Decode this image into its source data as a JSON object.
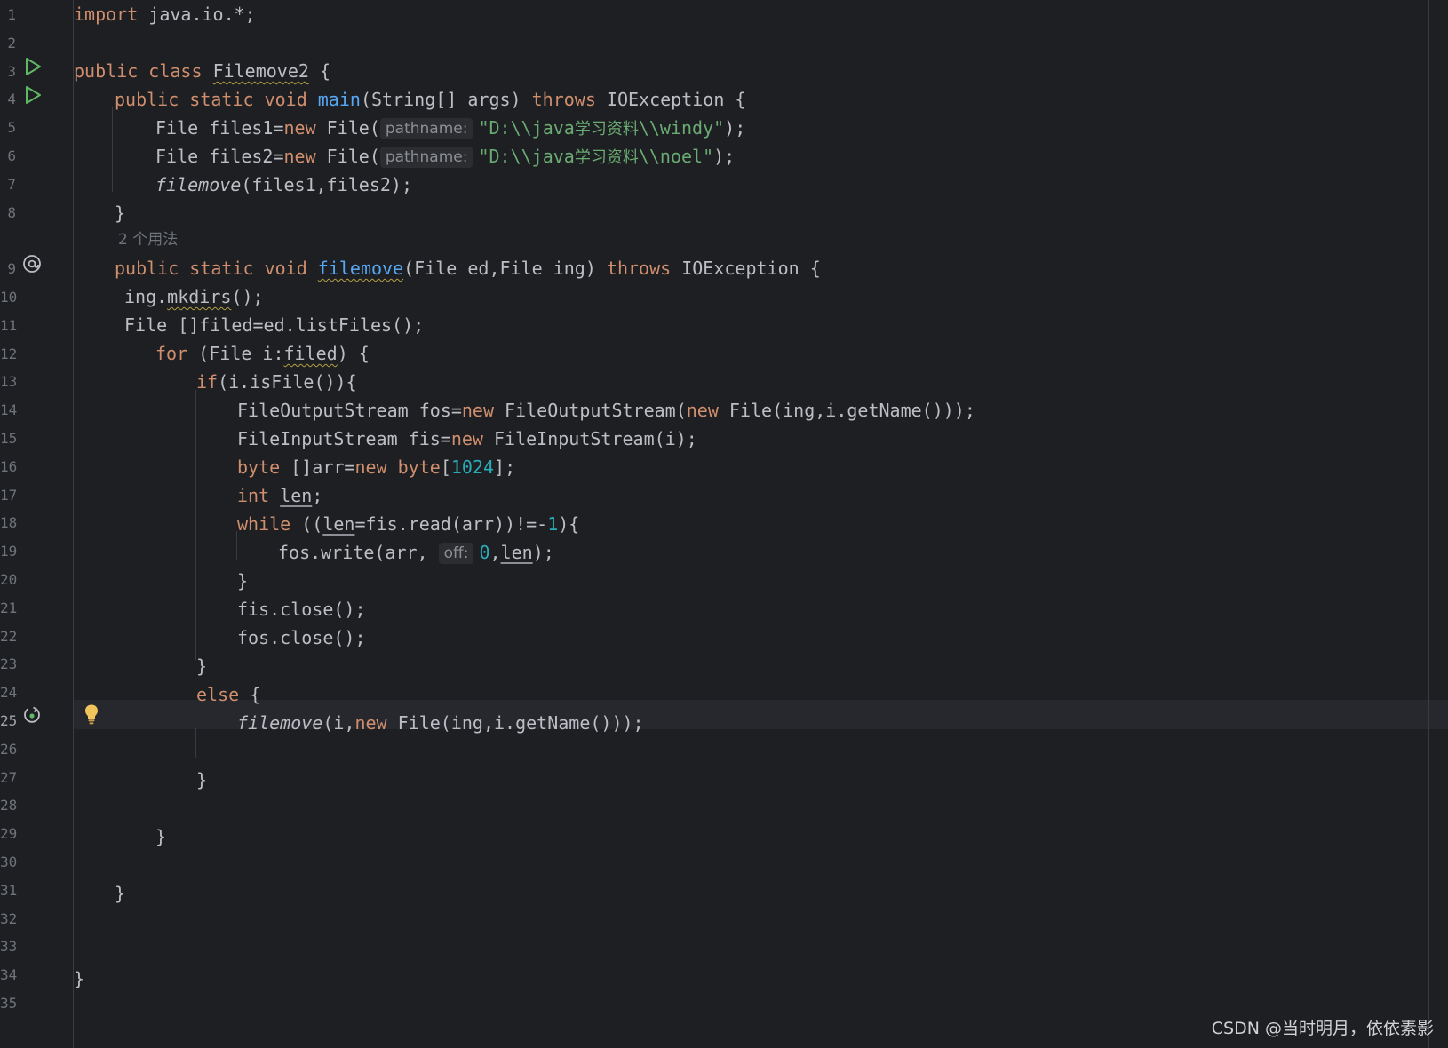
{
  "editor": {
    "line_numbers": [
      "1",
      "2",
      "3",
      "4",
      "5",
      "6",
      "7",
      "8",
      "9",
      "10",
      "11",
      "12",
      "13",
      "14",
      "15",
      "16",
      "17",
      "18",
      "19",
      "20",
      "21",
      "22",
      "23",
      "24",
      "25",
      "26",
      "27",
      "28",
      "29",
      "30",
      "31",
      "32",
      "33",
      "34",
      "35"
    ],
    "usage_hint": "2 个用法",
    "hints": {
      "pathname": "pathname:",
      "off": "off:"
    },
    "gutter_icons": {
      "run_line_3": "run-icon",
      "run_line_4": "run-icon",
      "override_line_9": "at-icon",
      "recursive_line_25": "recursive-call-icon",
      "intention_line_25": "lightbulb-icon"
    },
    "current_line": 25,
    "code": {
      "l1": {
        "kw": "import",
        "rest": " java.io.*;"
      },
      "l3": {
        "kw1": "public",
        "kw2": "class",
        "name": "Filemove2",
        "rest": " {"
      },
      "l4": {
        "kw": "public static void",
        "fn": "main",
        "p1": "(String[] args) ",
        "throws": "throws",
        "p2": " IOException {"
      },
      "l5": {
        "a": "File files1=",
        "new": "new",
        "b": " File(",
        "str1": "\"D:\\\\java",
        "cjk": "学习资料",
        "str2": "\\\\windy\"",
        "c": ");"
      },
      "l6": {
        "a": "File files2=",
        "new": "new",
        "b": " File(",
        "str1": "\"D:\\\\java",
        "cjk": "学习资料",
        "str2": "\\\\noel\"",
        "c": ");"
      },
      "l7": {
        "fn": "filemove",
        "rest": "(files1,files2);"
      },
      "l8": {
        "text": "}"
      },
      "l9": {
        "kw": "public static void",
        "fn": "filemove",
        "p1": "(File ed,File ing) ",
        "throws": "throws",
        "p2": " IOException {"
      },
      "l10": {
        "a": "ing.",
        "m": "mkdirs",
        "b": "();"
      },
      "l11": {
        "text": "File []filed=ed.listFiles();"
      },
      "l12": {
        "kw": "for",
        "a": " (File i:",
        "v": "filed",
        "b": ") {"
      },
      "l13": {
        "kw": "if",
        "rest": "(i.isFile()){"
      },
      "l14": {
        "a": "FileOutputStream fos=",
        "new1": "new",
        "b": " FileOutputStream(",
        "new2": "new",
        "c": " File(ing,i.getName()));"
      },
      "l15": {
        "a": "FileInputStream fis=",
        "new": "new",
        "b": " FileInputStream(i);"
      },
      "l16": {
        "kw1": "byte",
        "a": " []arr=",
        "kw2": "new",
        "kw3": "byte",
        "b": "[",
        "num": "1024",
        "c": "];"
      },
      "l17": {
        "kw": "int",
        "sp": " ",
        "v": "len",
        "rest": ";"
      },
      "l18": {
        "kw": "while",
        "a": " ((",
        "v": "len",
        "b": "=fis.read(arr))!=-",
        "num": "1",
        "c": "){"
      },
      "l19": {
        "a": "fos.write(arr, ",
        "num": "0",
        "b": ",",
        "v": "len",
        "c": ");"
      },
      "l20": {
        "text": "}"
      },
      "l21": {
        "text": "fis.close();"
      },
      "l22": {
        "text": "fos.close();"
      },
      "l23": {
        "text": "}"
      },
      "l24": {
        "kw": "else",
        "rest": " {"
      },
      "l25": {
        "fn": "filemove",
        "a": "(i,",
        "new": "new",
        "b": " File(ing,i.getName()));"
      },
      "l27": {
        "text": "}"
      },
      "l29": {
        "text": "}"
      },
      "l31": {
        "text": "}"
      },
      "l34": {
        "text": "}"
      }
    }
  },
  "watermark": "CSDN @当时明月，依依素影",
  "colors": {
    "background": "#1e1f22",
    "keyword": "#cf8e6d",
    "string": "#6aab73",
    "number": "#2aacb8",
    "function": "#56a8f5",
    "text": "#bcbec4"
  }
}
